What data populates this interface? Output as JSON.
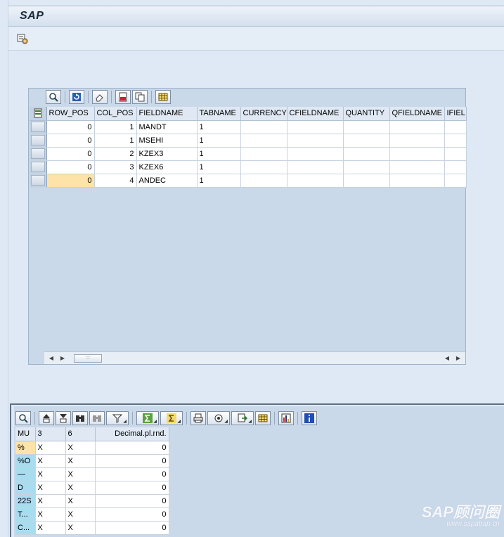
{
  "window": {
    "title": "SAP"
  },
  "upper_alv": {
    "columns": [
      "ROW_POS",
      "COL_POS",
      "FIELDNAME",
      "TABNAME",
      "CURRENCY",
      "CFIELDNAME",
      "QUANTITY",
      "QFIELDNAME",
      "IFIEL"
    ],
    "rows": [
      [
        "0",
        "1",
        "MANDT",
        "1",
        "",
        "",
        "",
        "",
        ""
      ],
      [
        "0",
        "1",
        "MSEHI",
        "1",
        "",
        "",
        "",
        "",
        ""
      ],
      [
        "0",
        "2",
        "KZEX3",
        "1",
        "",
        "",
        "",
        "",
        ""
      ],
      [
        "0",
        "3",
        "KZEX6",
        "1",
        "",
        "",
        "",
        "",
        ""
      ],
      [
        "0",
        "4",
        "ANDEC",
        "1",
        "",
        "",
        "",
        "",
        ""
      ]
    ]
  },
  "lower_alv": {
    "columns": [
      "MU",
      "3",
      "6",
      "Decimal.pl.rnd."
    ],
    "rows": [
      [
        "%",
        "X",
        "X",
        "0"
      ],
      [
        "%O",
        "X",
        "X",
        "0"
      ],
      [
        "—",
        "X",
        "X",
        "0"
      ],
      [
        "D",
        "X",
        "X",
        "0"
      ],
      [
        "22S",
        "X",
        "X",
        "0"
      ],
      [
        "T...",
        "X",
        "X",
        "0"
      ],
      [
        "C...",
        "X",
        "X",
        "0"
      ]
    ]
  },
  "watermark": {
    "brand": "SAP顾问圈",
    "url": "www.sapabap.cn"
  },
  "colors": {
    "highlight": "#fde3a7",
    "key_column": "#a9dcef",
    "grid_bg": "#cad9ea"
  }
}
